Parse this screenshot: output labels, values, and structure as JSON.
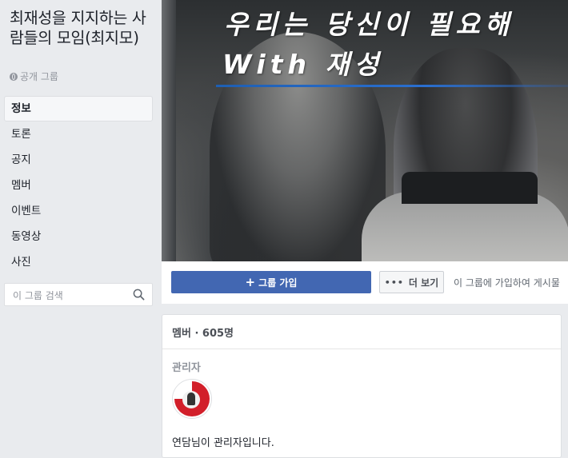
{
  "group": {
    "title": "최재성을 지지하는 사람들의 모임(최지모)",
    "privacy": "공개 그룹"
  },
  "nav": {
    "items": [
      {
        "label": "정보",
        "active": true
      },
      {
        "label": "토론"
      },
      {
        "label": "공지"
      },
      {
        "label": "멤버"
      },
      {
        "label": "이벤트"
      },
      {
        "label": "동영상"
      },
      {
        "label": "사진"
      }
    ]
  },
  "search": {
    "placeholder": "이 그룹 검색",
    "value": ""
  },
  "cover": {
    "line1": "우리는 당신이 필요해",
    "line2": "With 재성"
  },
  "actions": {
    "join_label": "그룹 가입",
    "more_label": "더 보기",
    "hint": "이 그룹에 가입하여 게시물"
  },
  "members": {
    "header": "멤버 · 605명",
    "admin_section": "관리자",
    "admin_text": "연담님이 관리자입니다."
  },
  "colors": {
    "primary": "#4267b2",
    "background": "#e9ebee",
    "avatar_accent": "#d21f2a"
  },
  "icons": [
    "globe-icon",
    "search-icon",
    "plus-icon",
    "more-dots-icon"
  ]
}
